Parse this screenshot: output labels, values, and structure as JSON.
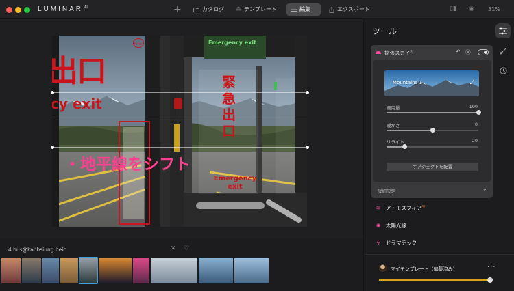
{
  "app": {
    "brand": "LUMINAR",
    "brand_sup": "AI"
  },
  "nav": [
    {
      "label": "カタログ",
      "icon": "folder-icon"
    },
    {
      "label": "テンプレート",
      "icon": "sparkle-wand-icon"
    },
    {
      "label": "編集",
      "icon": "sliders-icon",
      "active": true
    },
    {
      "label": "エクスポート",
      "icon": "export-icon"
    }
  ],
  "toolbar": {
    "zoom": "31%"
  },
  "canvas": {
    "overlay_text": "・地平線をシフト",
    "photo_signs": {
      "top_left": "出口",
      "top_left_en": "cy exit",
      "badge": "緊急出口",
      "right_kanji": "緊急出口",
      "right_en": "Emergency exit",
      "door_sign": "Emergency exit"
    }
  },
  "filmstrip": {
    "filename": "4.bus@kaohsiung.heic",
    "thumbs": [
      {
        "w": 28,
        "c1": "#6a3a3a",
        "c2": "#c88a6a"
      },
      {
        "w": 28,
        "c1": "#2a3a4a",
        "c2": "#8a7a6a"
      },
      {
        "w": 24,
        "c1": "#3a4a6a",
        "c2": "#6a8aaa"
      },
      {
        "w": 26,
        "c1": "#7a5a3a",
        "c2": "#c89a5a"
      },
      {
        "w": 26,
        "c1": "#2a3a3a",
        "c2": "#9aa0a8",
        "selected": true
      },
      {
        "w": 48,
        "c1": "#1a1a2a",
        "c2": "#e08a30"
      },
      {
        "w": 24,
        "c1": "#5a2a4a",
        "c2": "#e04a8a"
      },
      {
        "w": 68,
        "c1": "#7a8a9a",
        "c2": "#c8d0d8"
      },
      {
        "w": 50,
        "c1": "#3a5a7a",
        "c2": "#8ab0d0"
      },
      {
        "w": 50,
        "c1": "#4a6a8a",
        "c2": "#a0c0e0"
      }
    ]
  },
  "panel": {
    "title": "ツール",
    "side_icons": [
      "sliders-icon",
      "brush-icon",
      "clock-icon"
    ],
    "tool": {
      "title": "拡張スカイ",
      "title_sup": "AI",
      "preset_name": "Mountains 1",
      "sliders": [
        {
          "label": "適用量",
          "value": "100",
          "pos": 1.0
        },
        {
          "label": "暖かさ",
          "value": "0",
          "pos": 0.5
        },
        {
          "label": "リライト",
          "value": "20",
          "pos": 0.2
        }
      ],
      "place_button": "オブジェクトを配置",
      "details": "詳細設定"
    },
    "other_tools": [
      {
        "label": "アトモスフィア",
        "sup": "AI",
        "icon": "waves-icon",
        "glyph": "≋"
      },
      {
        "label": "太陽光線",
        "sup": "",
        "icon": "sun-rays-icon",
        "glyph": "✺"
      },
      {
        "label": "ドラマチック",
        "sup": "",
        "icon": "lightning-icon",
        "glyph": "ϟ"
      }
    ],
    "template": {
      "label": "マイテンプレート（編集済み）",
      "more": "···",
      "amount": 1.0
    }
  }
}
